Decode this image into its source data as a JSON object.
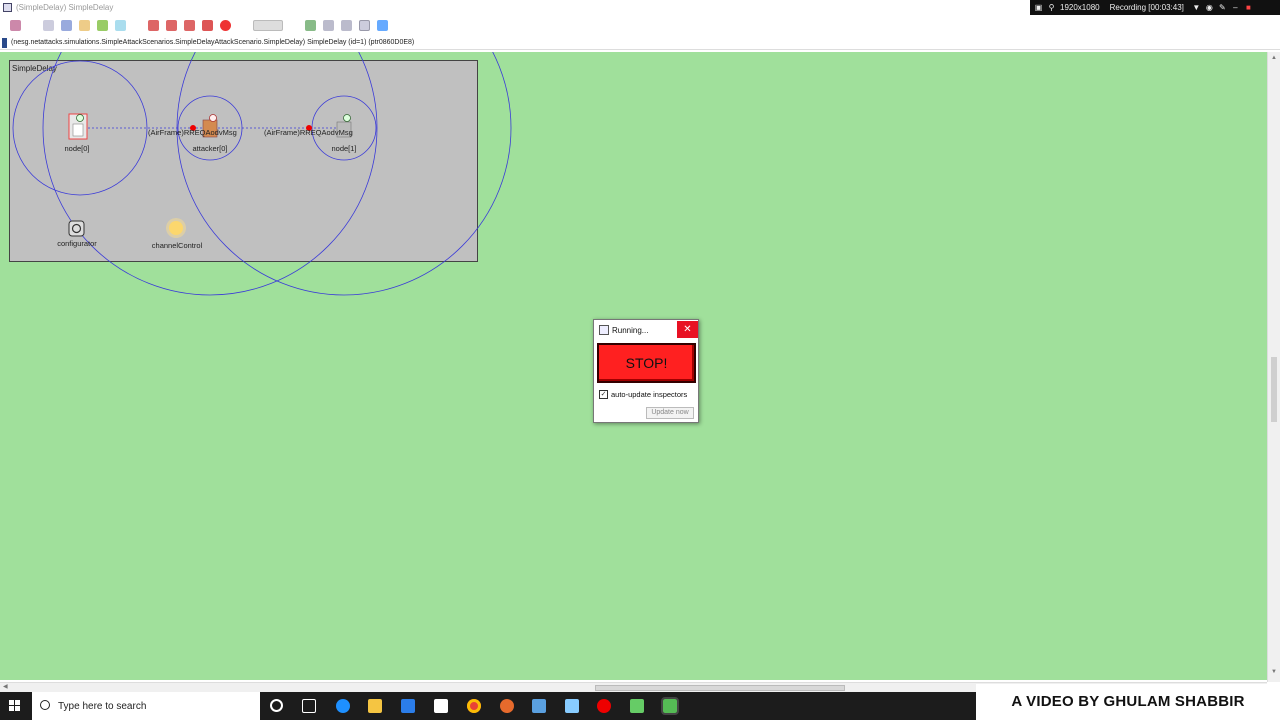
{
  "window": {
    "title": "(SimpleDelay) SimpleDelay"
  },
  "recorder": {
    "resolution": "1920x1080",
    "status": "Recording [00:03:43]"
  },
  "toolbar": {
    "icons": [
      "rewind-icon",
      "run-icon",
      "stop-icon",
      "grid-icon",
      "refresh-icon",
      "zoom-in-icon",
      "zoom-out-icon",
      "label-icon",
      "arrow-icon"
    ]
  },
  "path": {
    "text": "(nesg.netattacks.simulations.SimpleAttackScenarios.SimpleDelayAttackScenario.SimpleDelay) SimpleDelay (id=1) (ptr0860D0E8)"
  },
  "network": {
    "module_title": "SimpleDelay",
    "nodes": [
      {
        "label": "node[0]"
      },
      {
        "label": "attacker[0]"
      },
      {
        "label": "node[1]"
      },
      {
        "label": "configurator"
      },
      {
        "label": "channelControl"
      }
    ],
    "messages": [
      {
        "label": "(AirFrame)RREQAodvMsg"
      },
      {
        "label": "(AirFrame)RREQAodvMsg"
      }
    ]
  },
  "dialog": {
    "title": "Running...",
    "stop_label": "STOP!",
    "auto_update_label": "auto-update inspectors",
    "auto_update_checked": true,
    "update_now_label": "Update now"
  },
  "taskbar": {
    "search_placeholder": "Type here to search"
  },
  "watermark": {
    "text": "A VIDEO BY GHULAM SHABBIR"
  },
  "colors": {
    "canvas": "#a0e09b",
    "module": "#c0c0c0",
    "range_circle": "#3a3ad8",
    "stop_button": "#ff2020"
  }
}
